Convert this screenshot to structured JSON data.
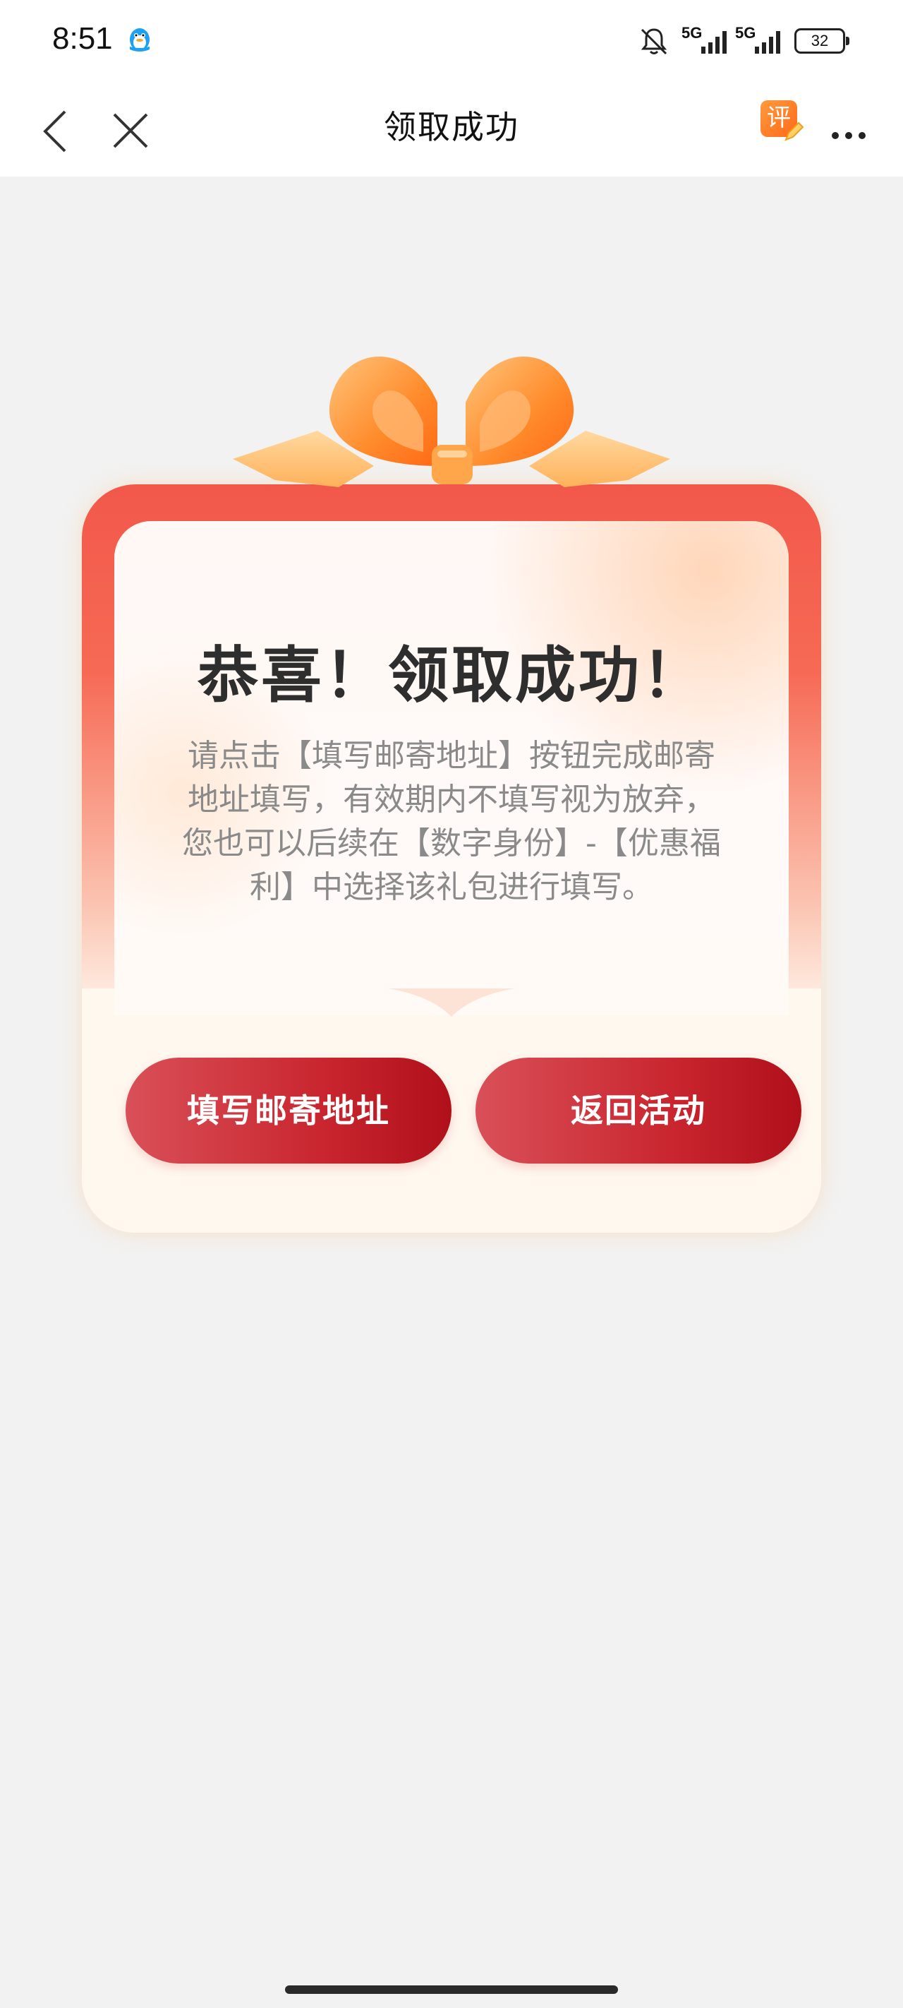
{
  "status_bar": {
    "time": "8:51",
    "battery": "32",
    "network_labels": [
      "5G",
      "5G"
    ],
    "icons": [
      "qq-icon",
      "mute-bell-icon",
      "signal-icon",
      "signal-icon",
      "battery-icon"
    ]
  },
  "nav": {
    "title": "领取成功",
    "review_label": "评",
    "icons": [
      "back-icon",
      "close-icon",
      "review-icon",
      "more-icon"
    ]
  },
  "card": {
    "title": "恭喜！领取成功！",
    "message_lines": [
      "请点击【填写邮寄地址】按钮完成邮寄",
      "地址填写，有效期内不填写视为放弃，",
      "您也可以后续在【数字身份】-【优惠福",
      "利】中选择该礼包进行填写。"
    ],
    "fill_address_button": "填写邮寄地址",
    "back_to_event_button": "返回活动"
  },
  "colors": {
    "button_start": "#d95058",
    "button_end": "#b0101a",
    "card_top": "#f2584a",
    "ribbon": "#ff8c2e",
    "background": "#f2f2f2"
  }
}
